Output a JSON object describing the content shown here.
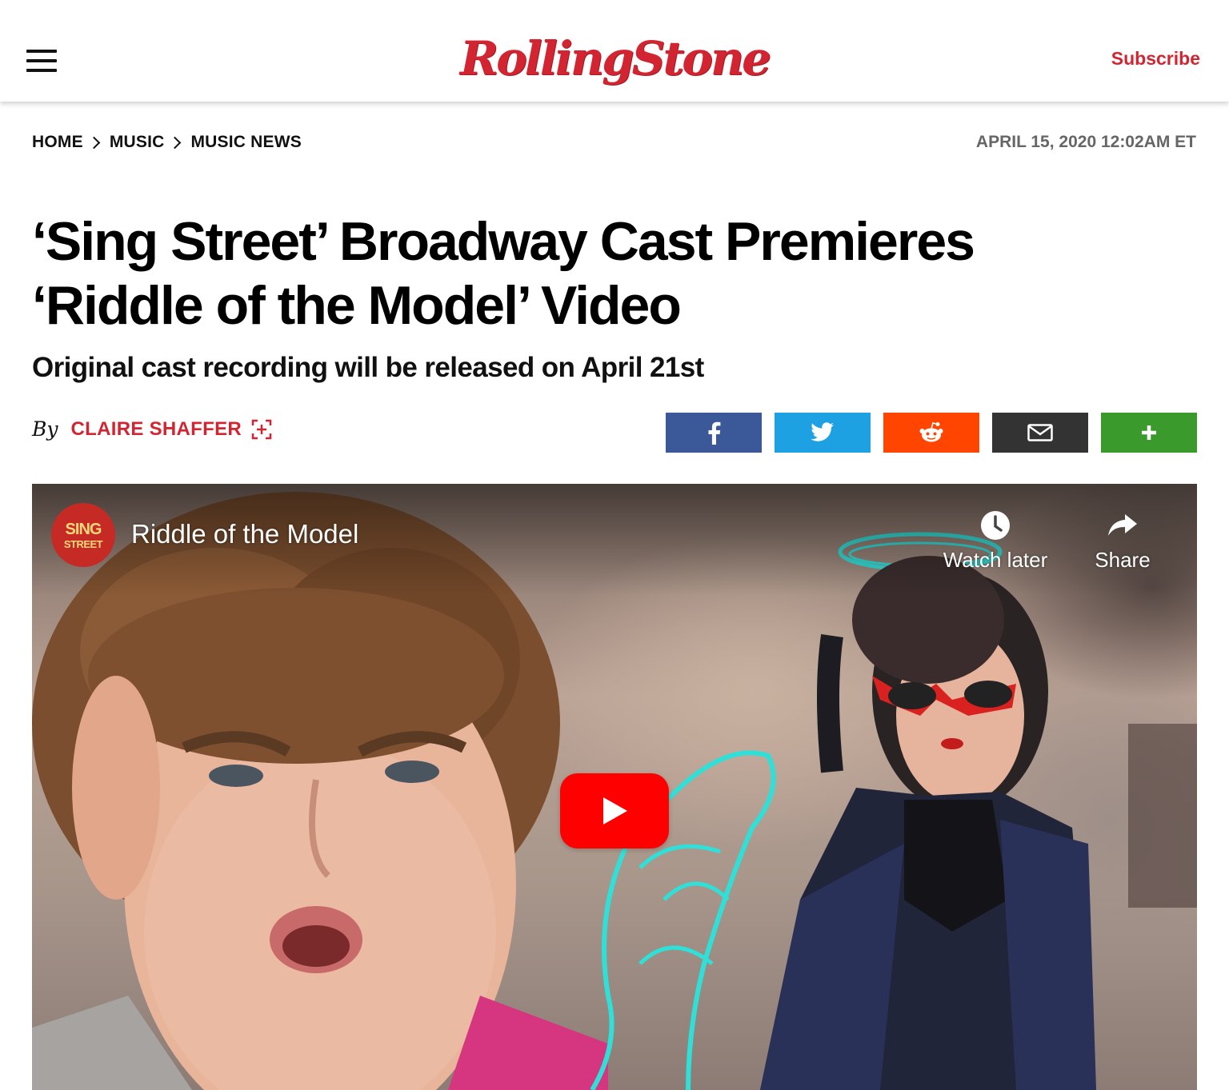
{
  "header": {
    "logo_text": "RollingStone",
    "subscribe_label": "Subscribe",
    "brand_color": "#d32531"
  },
  "breadcrumb": [
    "HOME",
    "MUSIC",
    "MUSIC NEWS"
  ],
  "dateline": "APRIL 15, 2020 12:02AM ET",
  "article": {
    "headline_line1": "‘Sing Street’ Broadway Cast Premieres",
    "headline_line2": "‘Riddle of the Model’ Video",
    "dek": "Original cast recording will be released on April 21st",
    "by_label": "By",
    "author": "CLAIRE SHAFFER"
  },
  "share_buttons": [
    {
      "name": "facebook",
      "icon": "facebook-icon",
      "color": "#3b5998"
    },
    {
      "name": "twitter",
      "icon": "twitter-icon",
      "color": "#1da1e2"
    },
    {
      "name": "reddit",
      "icon": "reddit-icon",
      "color": "#ff4500"
    },
    {
      "name": "email",
      "icon": "mail-icon",
      "color": "#333333"
    },
    {
      "name": "more",
      "icon": "plus-icon",
      "color": "#3a9a2c"
    }
  ],
  "video": {
    "channel_line1": "SING",
    "channel_line2": "STREET",
    "title": "Riddle of the Model",
    "watch_later_label": "Watch later",
    "share_label": "Share",
    "play_color": "#ff0000"
  }
}
